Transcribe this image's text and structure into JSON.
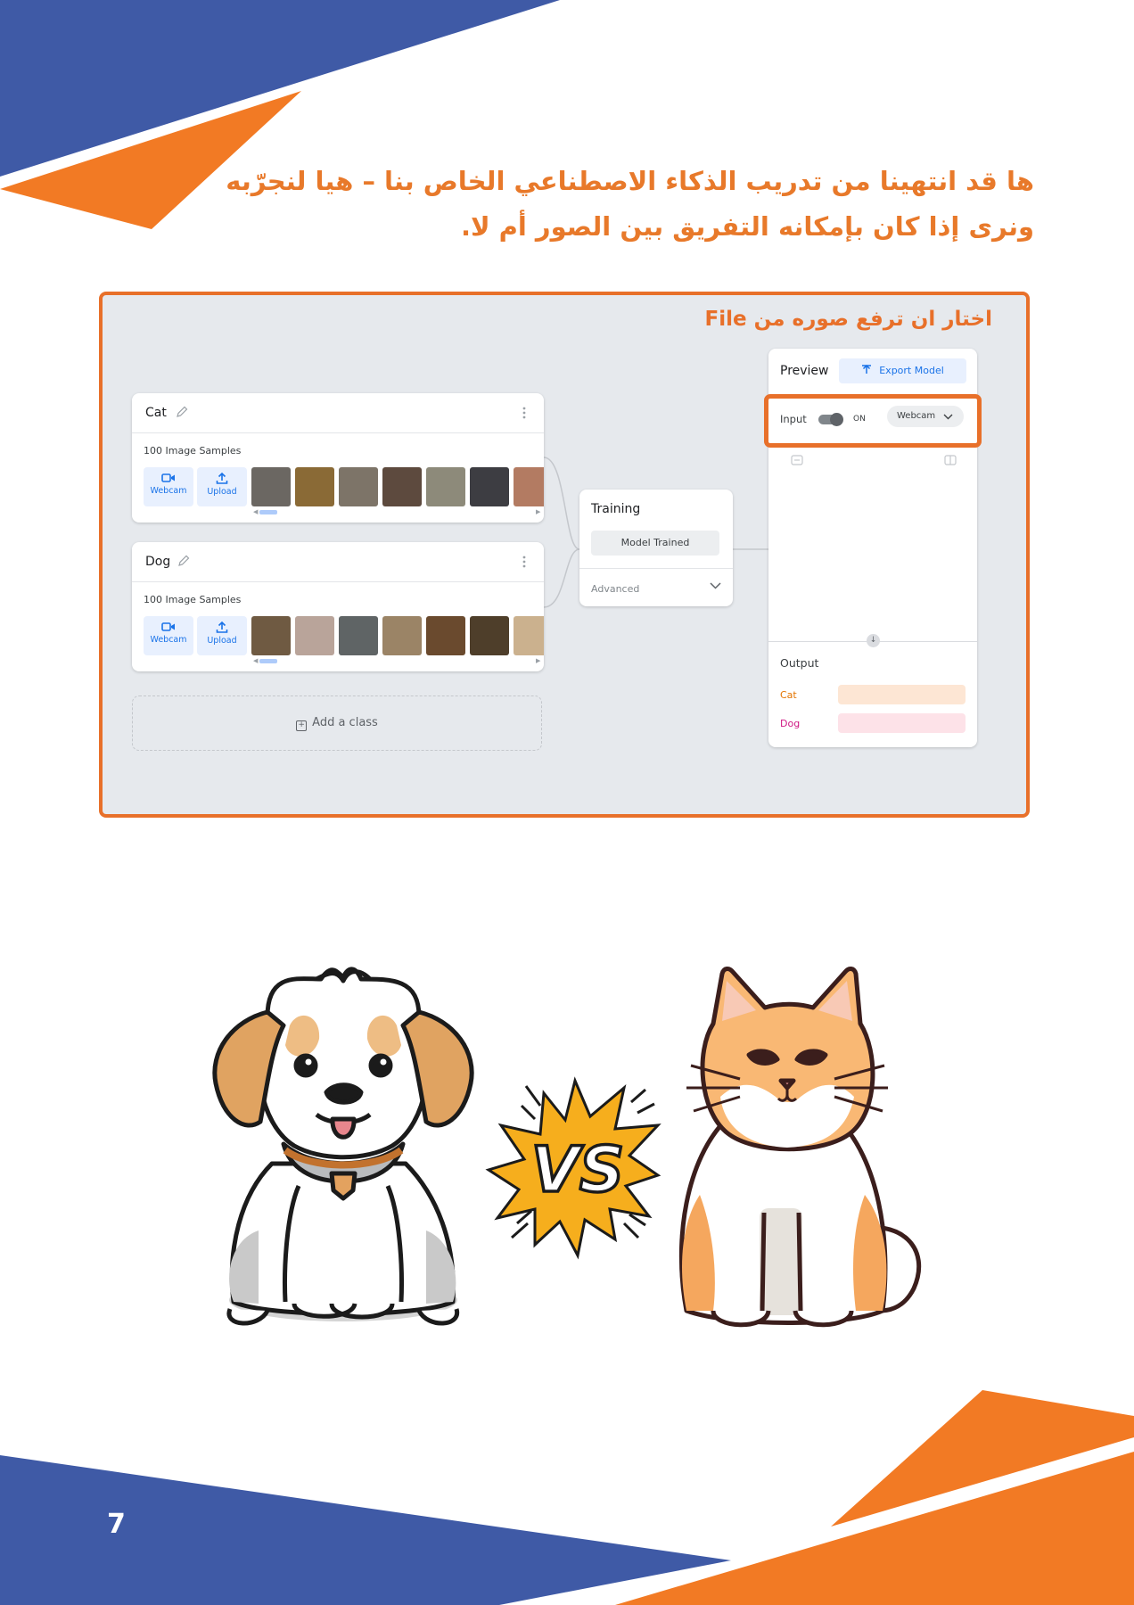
{
  "colors": {
    "brand_blue": "#3f5aa6",
    "brand_orange": "#f27a24",
    "heading_orange": "#e8792a",
    "frame_orange": "#e8702a",
    "link_blue": "#1a73e8"
  },
  "heading": {
    "line1": "ها قد انتهينا من تدريب الذكاء الاصطناعي الخاص بنا – هيا لنجرّبه",
    "line2": "ونرى إذا كان بإمكانه التفريق بين الصور أم لا."
  },
  "screenshot": {
    "instruction": "اختار ان ترفع صوره من File",
    "classes": [
      {
        "name": "Cat",
        "samples": "100 Image Samples",
        "webcam_label": "Webcam",
        "upload_label": "Upload",
        "thumb_colors": [
          "#6b6762",
          "#8a6a36",
          "#7d7468",
          "#5d4a3e",
          "#8d8a7a",
          "#3d3d42",
          "#b37b62"
        ]
      },
      {
        "name": "Dog",
        "samples": "100 Image Samples",
        "webcam_label": "Webcam",
        "upload_label": "Upload",
        "thumb_colors": [
          "#6f5a42",
          "#b9a49a",
          "#5f6465",
          "#9b8466",
          "#6a4a2e",
          "#4e3e2a",
          "#cbb18e"
        ]
      }
    ],
    "add_class": "Add a class",
    "training": {
      "title": "Training",
      "button": "Model Trained",
      "advanced": "Advanced"
    },
    "preview": {
      "title": "Preview",
      "export": "Export Model",
      "input_label": "Input",
      "toggle_state": "ON",
      "source": "Webcam",
      "output_title": "Output",
      "outputs": [
        {
          "label": "Cat",
          "color": "#e37400",
          "bar_color": "#fde6d4"
        },
        {
          "label": "Dog",
          "color": "#d01884",
          "bar_color": "#fde2e8"
        }
      ]
    }
  },
  "illustration": {
    "vs_text": "VS",
    "left_icon": "puppy-illustration",
    "right_icon": "cat-illustration"
  },
  "page_number": "7"
}
